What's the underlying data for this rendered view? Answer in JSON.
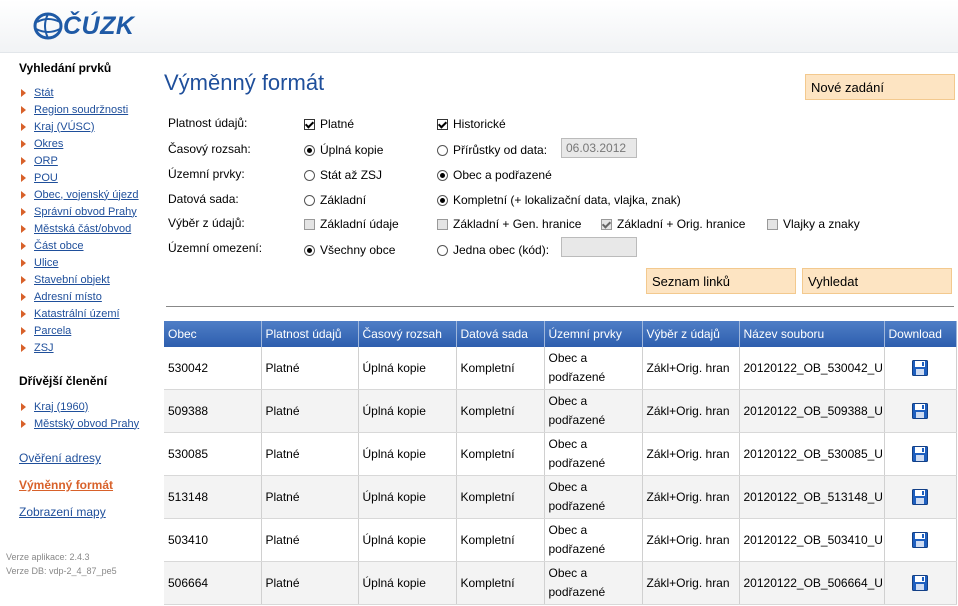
{
  "logo": {
    "text": "ČÚZK"
  },
  "sidebar": {
    "section1_title": "Vyhledání prvků",
    "section1_items": [
      "Stát",
      "Region soudržnosti",
      "Kraj (VÚSC)",
      "Okres",
      "ORP",
      "POU",
      "Obec, vojenský újezd",
      "Správní obvod Prahy",
      "Městská část/obvod",
      "Část obce",
      "Ulice",
      "Stavební objekt",
      "Adresní místo",
      "Katastrální území",
      "Parcela",
      "ZSJ"
    ],
    "section2_title": "Dřívější členění",
    "section2_items": [
      "Kraj (1960)",
      "Městský obvod Prahy"
    ],
    "nav": [
      "Ověření adresy",
      "Výměnný formát",
      "Zobrazení mapy"
    ],
    "version_app": "Verze aplikace: 2.4.3",
    "version_db": "Verze DB: vdp-2_4_87_pe5"
  },
  "main": {
    "title": "Výměnný formát",
    "new_button": "Nové zadání",
    "labels": [
      "Platnost údajů:",
      "Časový rozsah:",
      "Územní prvky:",
      "Datová sada:",
      "Výběr z údajů:",
      "Územní omezení:"
    ],
    "validity": {
      "current": "Platné",
      "historic": "Historické"
    },
    "time_range": {
      "full": "Úplná kopie",
      "increments": "Přírůstky od data:",
      "date_value": "06.03.2012"
    },
    "territorial": {
      "state_to_zsj": "Stát až ZSJ",
      "municipality_sub": "Obec a podřazené"
    },
    "dataset": {
      "basic": "Základní",
      "complete": "Kompletní (+ lokalizační data, vlajka, znak)"
    },
    "selection": {
      "basic": "Základní údaje",
      "basic_gen": "Základní + Gen. hranice",
      "basic_orig": "Základní + Orig. hranice",
      "flags": "Vlajky a znaky"
    },
    "restriction": {
      "all": "Všechny obce",
      "one": "Jedna obec (kód):"
    },
    "links_button": "Seznam linků",
    "search_button": "Vyhledat"
  },
  "table": {
    "headers": [
      "Obec",
      "Platnost údajů",
      "Časový rozsah",
      "Datová sada",
      "Územní prvky",
      "Výběr z údajů",
      "Název souboru",
      "Download"
    ],
    "rows": [
      [
        "530042",
        "Platné",
        "Úplná kopie",
        "Kompletní",
        "Obec a podřazené",
        "Zákl+Orig. hran",
        "20120122_OB_530042_U"
      ],
      [
        "509388",
        "Platné",
        "Úplná kopie",
        "Kompletní",
        "Obec a podřazené",
        "Zákl+Orig. hran",
        "20120122_OB_509388_U"
      ],
      [
        "530085",
        "Platné",
        "Úplná kopie",
        "Kompletní",
        "Obec a podřazené",
        "Zákl+Orig. hran",
        "20120122_OB_530085_U"
      ],
      [
        "513148",
        "Platné",
        "Úplná kopie",
        "Kompletní",
        "Obec a podřazené",
        "Zákl+Orig. hran",
        "20120122_OB_513148_U"
      ],
      [
        "503410",
        "Platné",
        "Úplná kopie",
        "Kompletní",
        "Obec a podřazené",
        "Zákl+Orig. hran",
        "20120122_OB_503410_U"
      ],
      [
        "506664",
        "Platné",
        "Úplná kopie",
        "Kompletní",
        "Obec a podřazené",
        "Zákl+Orig. hran",
        "20120122_OB_506664_U"
      ]
    ]
  },
  "colors": {
    "link": "#1f4f9b",
    "accent": "#d8612a",
    "header_blue": "#2d5eae",
    "button_bg": "#fde4c2"
  }
}
